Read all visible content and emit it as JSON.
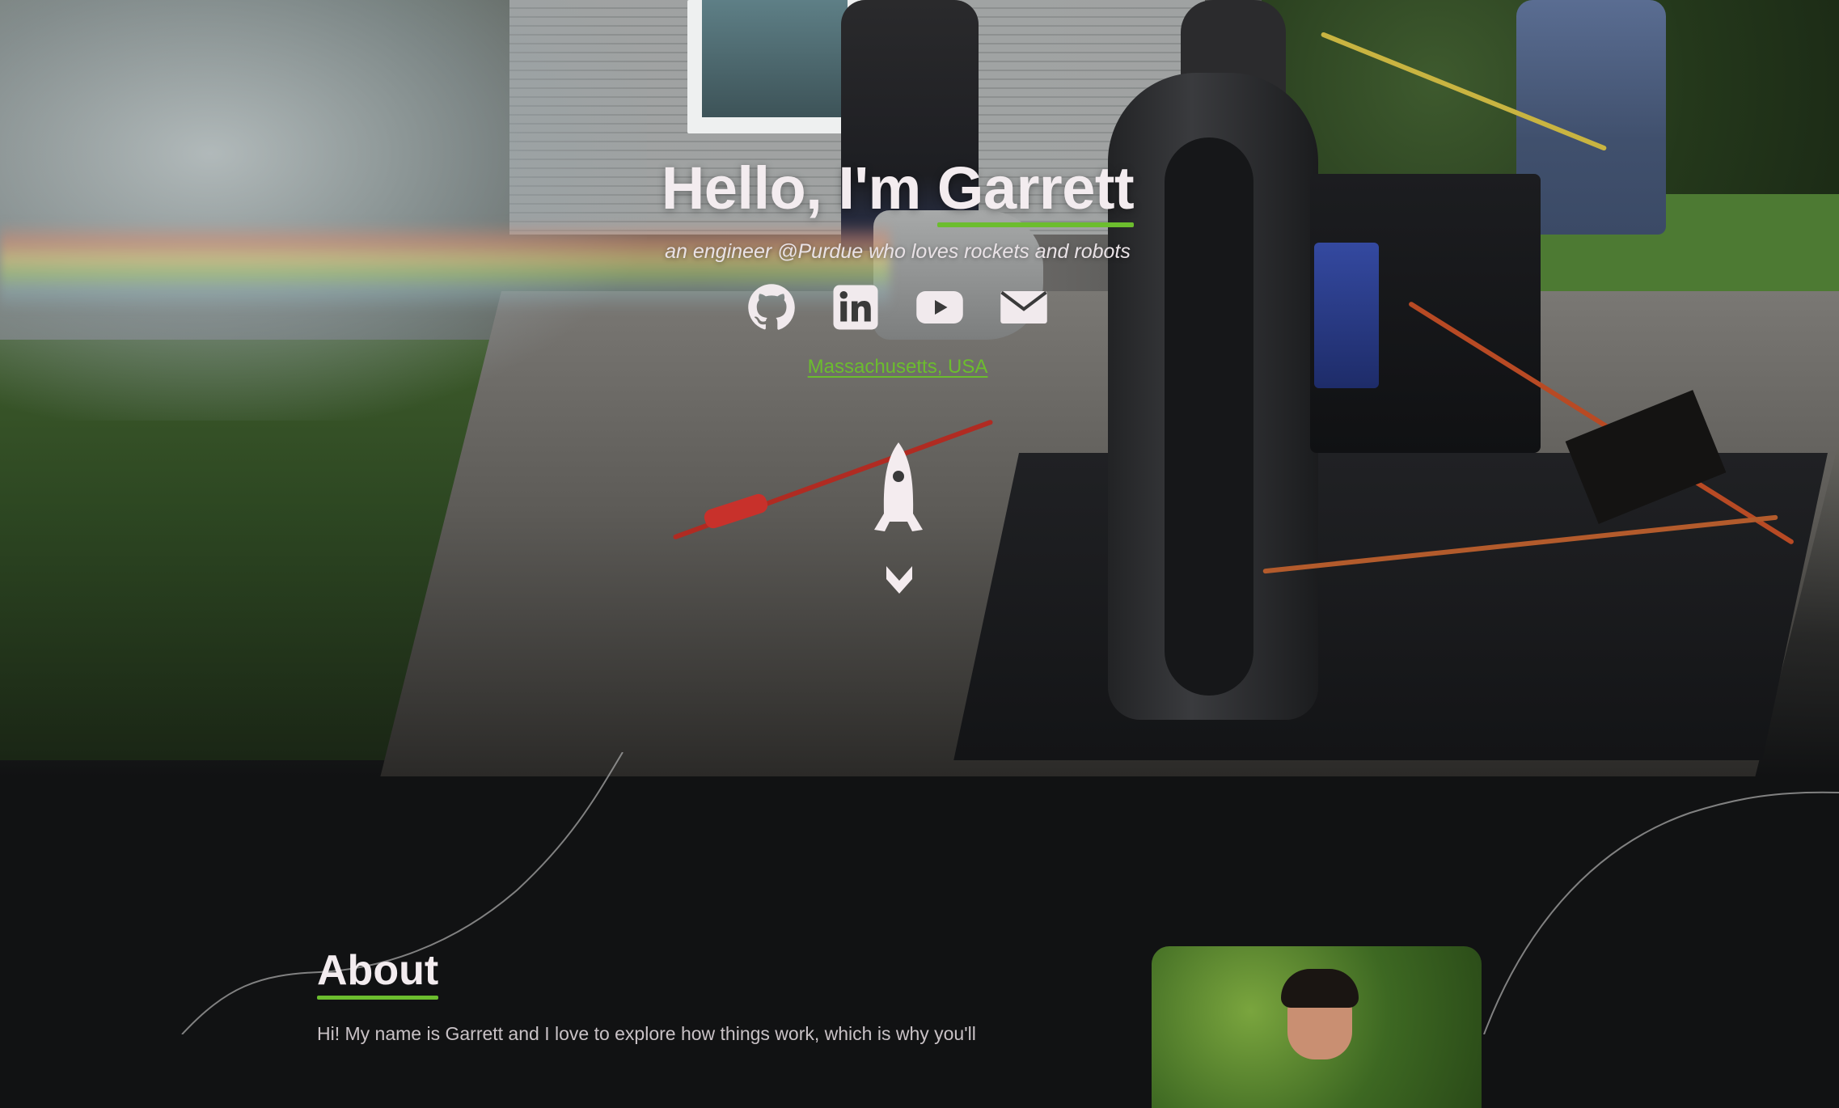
{
  "hero": {
    "title_prefix": "Hello, I'm ",
    "title_name": "Garrett",
    "subtitle": "an engineer @Purdue who loves rockets and robots",
    "location": "Massachusetts, USA",
    "socials": [
      {
        "name": "github",
        "icon": "github-icon"
      },
      {
        "name": "linkedin",
        "icon": "linkedin-icon"
      },
      {
        "name": "youtube",
        "icon": "youtube-icon"
      },
      {
        "name": "email",
        "icon": "mail-icon"
      }
    ]
  },
  "about": {
    "title": "About",
    "intro": "Hi! My name is Garrett and I love to explore how things work, which is why you'll"
  },
  "colors": {
    "accent": "#6cbd2e",
    "background": "#111213",
    "text": "#f1eaed"
  }
}
